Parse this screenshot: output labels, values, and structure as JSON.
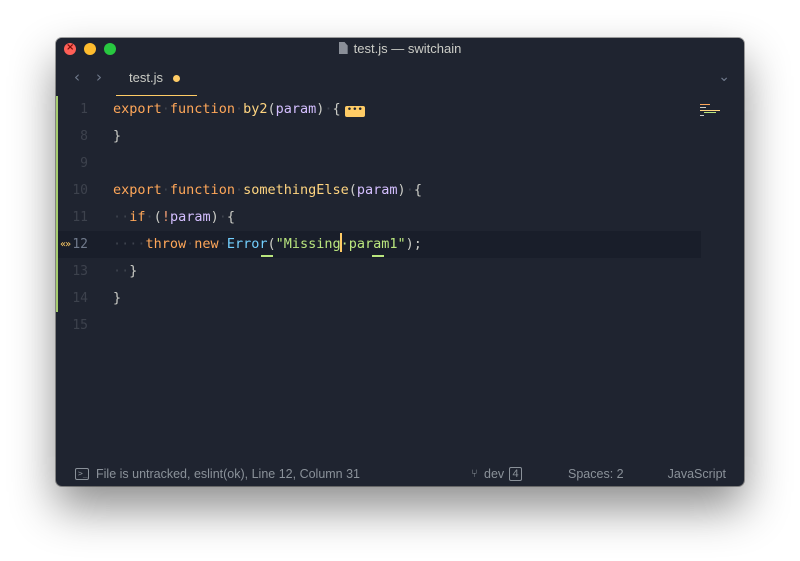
{
  "window": {
    "title": "test.js — switchain"
  },
  "tabs": [
    {
      "label": "test.js",
      "modified": true
    }
  ],
  "nav": {
    "back_glyph": "‹",
    "forward_glyph": "›",
    "dropdown_glyph": "⌄"
  },
  "editor": {
    "lines": [
      {
        "number": "1"
      },
      {
        "number": "8"
      },
      {
        "number": "9"
      },
      {
        "number": "10"
      },
      {
        "number": "11"
      },
      {
        "number": "12"
      },
      {
        "number": "13"
      },
      {
        "number": "14"
      },
      {
        "number": "15"
      }
    ],
    "tokens": {
      "export": "export",
      "function": "function",
      "by2": "by2",
      "param": "param",
      "fold_badge": "•••",
      "close_brace": "}",
      "open_brace": "{",
      "somethingElse": "somethingElse",
      "if": "if",
      "not_op": "!",
      "throw": "throw",
      "new": "new",
      "error_type": "Error",
      "string_a": "\"Missing",
      "string_b": "·param1\"",
      "semicolon": ");",
      "lens_glyph": "«»"
    }
  },
  "statusbar": {
    "message": "File is untracked, eslint(ok), Line 12, Column 31",
    "terminal_glyph": ">_",
    "branch": "dev",
    "branch_count": "4",
    "spaces": "Spaces: 2",
    "language": "JavaScript"
  },
  "colors": {
    "background": "#1f2430",
    "keyword": "#ffa759",
    "function": "#ffd580",
    "parameter": "#d4bfff",
    "type": "#73d0ff",
    "string": "#bae67e",
    "accent": "#ffcc66",
    "gutter_added": "#a6cc70"
  }
}
